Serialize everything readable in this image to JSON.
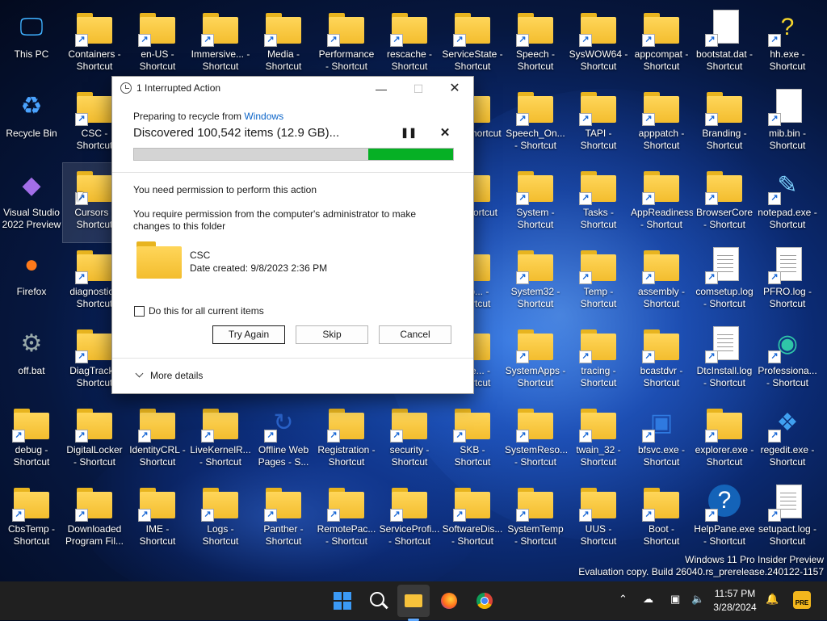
{
  "desktop": {
    "icons": [
      {
        "label": "This PC",
        "icon": "monitor-icon"
      },
      {
        "label": "Containers - Shortcut",
        "icon": "folder-icon"
      },
      {
        "label": "en-US - Shortcut",
        "icon": "folder-icon"
      },
      {
        "label": "Immersive... - Shortcut",
        "icon": "folder-icon"
      },
      {
        "label": "Media - Shortcut",
        "icon": "folder-icon"
      },
      {
        "label": "Performance - Shortcut",
        "icon": "folder-icon"
      },
      {
        "label": "rescache - Shortcut",
        "icon": "folder-icon"
      },
      {
        "label": "ServiceState - Shortcut",
        "icon": "folder-icon"
      },
      {
        "label": "Speech - Shortcut",
        "icon": "folder-icon"
      },
      {
        "label": "SysWOW64 - Shortcut",
        "icon": "folder-icon"
      },
      {
        "label": "appcompat - Shortcut",
        "icon": "folder-icon"
      },
      {
        "label": "bootstat.dat - Shortcut",
        "icon": "file-icon"
      },
      {
        "label": "hh.exe - Shortcut",
        "icon": "help-file-icon"
      },
      {
        "label": "Recycle Bin",
        "icon": "recycle-bin-icon"
      },
      {
        "label": "CSC - Shortcut",
        "icon": "folder-icon"
      },
      {
        "label": "ing - Shortcut",
        "icon": "folder-icon"
      },
      {
        "label": "Speech_On... - Shortcut",
        "icon": "folder-icon"
      },
      {
        "label": "TAPI - Shortcut",
        "icon": "folder-icon"
      },
      {
        "label": "apppatch - Shortcut",
        "icon": "folder-icon"
      },
      {
        "label": "Branding - Shortcut",
        "icon": "folder-icon"
      },
      {
        "label": "mib.bin - Shortcut",
        "icon": "file-icon"
      },
      {
        "label": "Visual Studio 2022 Preview",
        "icon": "visual-studio-icon"
      },
      {
        "label": "Cursors - Shortcut",
        "icon": "folder-icon"
      },
      {
        "label": "p - Shortcut",
        "icon": "folder-icon"
      },
      {
        "label": "System - Shortcut",
        "icon": "folder-icon"
      },
      {
        "label": "Tasks - Shortcut",
        "icon": "folder-icon"
      },
      {
        "label": "AppReadiness - Shortcut",
        "icon": "folder-icon"
      },
      {
        "label": "BrowserCore - Shortcut",
        "icon": "folder-icon"
      },
      {
        "label": "notepad.exe - Shortcut",
        "icon": "notepad-icon"
      },
      {
        "label": "Firefox",
        "icon": "firefox-icon"
      },
      {
        "label": "diagnostic - Shortcut",
        "icon": "folder-icon"
      },
      {
        "label": "omp... - Shortcut",
        "icon": "folder-icon"
      },
      {
        "label": "System32 - Shortcut",
        "icon": "folder-icon"
      },
      {
        "label": "Temp - Shortcut",
        "icon": "folder-icon"
      },
      {
        "label": "assembly - Shortcut",
        "icon": "folder-icon"
      },
      {
        "label": "comsetup.log - Shortcut",
        "icon": "log-file-icon"
      },
      {
        "label": "PFRO.log - Shortcut",
        "icon": "log-file-icon"
      },
      {
        "label": "off.bat",
        "icon": "batch-file-icon"
      },
      {
        "label": "DiagTrack - Shortcut",
        "icon": "folder-icon"
      },
      {
        "label": "perie... - Shortcut",
        "icon": "folder-icon"
      },
      {
        "label": "SystemApps - Shortcut",
        "icon": "folder-icon"
      },
      {
        "label": "tracing - Shortcut",
        "icon": "folder-icon"
      },
      {
        "label": "bcastdvr - Shortcut",
        "icon": "folder-icon"
      },
      {
        "label": "DtcInstall.log - Shortcut",
        "icon": "log-file-icon"
      },
      {
        "label": "Professiona... - Shortcut",
        "icon": "edge-icon"
      },
      {
        "label": "debug - Shortcut",
        "icon": "folder-icon"
      },
      {
        "label": "DigitalLocker - Shortcut",
        "icon": "folder-icon"
      },
      {
        "label": "IdentityCRL - Shortcut",
        "icon": "folder-icon"
      },
      {
        "label": "LiveKernelR... - Shortcut",
        "icon": "folder-icon"
      },
      {
        "label": "Offline Web Pages - S...",
        "icon": "offline-pages-icon"
      },
      {
        "label": "Registration - Shortcut",
        "icon": "folder-icon"
      },
      {
        "label": "security - Shortcut",
        "icon": "folder-icon"
      },
      {
        "label": "SKB - Shortcut",
        "icon": "folder-icon"
      },
      {
        "label": "SystemReso... - Shortcut",
        "icon": "folder-icon"
      },
      {
        "label": "twain_32 - Shortcut",
        "icon": "folder-icon"
      },
      {
        "label": "bfsvc.exe - Shortcut",
        "icon": "app-window-icon"
      },
      {
        "label": "explorer.exe - Shortcut",
        "icon": "folder-icon"
      },
      {
        "label": "regedit.exe - Shortcut",
        "icon": "regedit-icon"
      },
      {
        "label": "CbsTemp - Shortcut",
        "icon": "folder-icon"
      },
      {
        "label": "Downloaded Program Fil...",
        "icon": "folder-icon"
      },
      {
        "label": "IME - Shortcut",
        "icon": "folder-icon"
      },
      {
        "label": "Logs - Shortcut",
        "icon": "folder-icon"
      },
      {
        "label": "Panther - Shortcut",
        "icon": "folder-icon"
      },
      {
        "label": "RemotePac... - Shortcut",
        "icon": "folder-icon"
      },
      {
        "label": "ServiceProfi... - Shortcut",
        "icon": "folder-icon"
      },
      {
        "label": "SoftwareDis... - Shortcut",
        "icon": "folder-icon"
      },
      {
        "label": "SystemTemp - Shortcut",
        "icon": "folder-icon"
      },
      {
        "label": "UUS - Shortcut",
        "icon": "folder-icon"
      },
      {
        "label": "Boot - Shortcut",
        "icon": "folder-icon"
      },
      {
        "label": "HelpPane.exe - Shortcut",
        "icon": "help-icon"
      },
      {
        "label": "setupact.log - Shortcut",
        "icon": "log-file-icon"
      }
    ]
  },
  "dialog": {
    "title": "1 Interrupted Action",
    "preparing_prefix": "Preparing to recycle from ",
    "preparing_link": "Windows",
    "discovered": "Discovered 100,542 items (12.9 GB)...",
    "progress_fraction": 0.265,
    "need_permission": "You need permission to perform this action",
    "require_permission": "You require permission from the computer's administrator to make changes to this folder",
    "item_name": "CSC",
    "item_date": "Date created: 9/8/2023 2:36 PM",
    "checkbox_label": "Do this for all current items",
    "try_again": "Try Again",
    "skip": "Skip",
    "cancel": "Cancel",
    "more_details": "More details"
  },
  "watermark": {
    "line1": "Windows 11 Pro Insider Preview",
    "line2": "Evaluation copy. Build 26040.rs_prerelease.240122-1157"
  },
  "taskbar": {
    "time": "11:57 PM",
    "date": "3/28/2024",
    "pre_badge": "PRE"
  }
}
